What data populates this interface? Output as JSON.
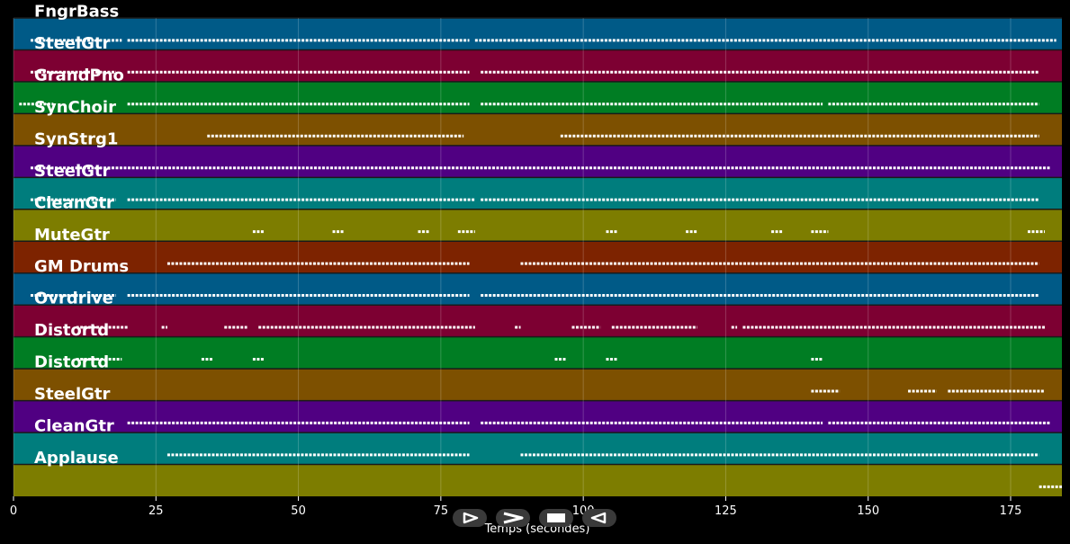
{
  "chart_data": {
    "type": "piano-roll",
    "xlabel": "Temps (secondes)",
    "xlim": [
      0,
      184
    ],
    "xticks": [
      0,
      25,
      50,
      75,
      100,
      125,
      150,
      175
    ],
    "grid": true,
    "tracks": [
      {
        "name": "FngrBass",
        "color": "#005a87",
        "segments": [
          [
            3,
            19
          ],
          [
            20,
            80
          ],
          [
            81,
            183
          ]
        ]
      },
      {
        "name": "SteelGtr",
        "color": "#7d0032",
        "segments": [
          [
            3,
            18
          ],
          [
            20,
            80
          ],
          [
            82,
            180
          ]
        ]
      },
      {
        "name": "GrandPno",
        "color": "#007d23",
        "segments": [
          [
            1,
            7
          ],
          [
            20,
            80
          ],
          [
            82,
            142
          ],
          [
            143,
            180
          ]
        ]
      },
      {
        "name": "SynChoir",
        "color": "#7d5000",
        "segments": [
          [
            34,
            79
          ],
          [
            96,
            180
          ]
        ]
      },
      {
        "name": "SynStrg1",
        "color": "#500082",
        "segments": [
          [
            3,
            182
          ]
        ]
      },
      {
        "name": "SteelGtr",
        "color": "#007d7d",
        "segments": [
          [
            3,
            18
          ],
          [
            20,
            81
          ],
          [
            82,
            180
          ]
        ]
      },
      {
        "name": "CleanGtr",
        "color": "#7d7d00",
        "segments": [
          [
            42,
            44
          ],
          [
            56,
            58
          ],
          [
            71,
            73
          ],
          [
            78,
            81
          ],
          [
            104,
            106
          ],
          [
            118,
            120
          ],
          [
            133,
            135
          ],
          [
            140,
            143
          ],
          [
            178,
            181
          ]
        ]
      },
      {
        "name": "MuteGtr",
        "color": "#7d2300",
        "segments": [
          [
            27,
            80
          ],
          [
            89,
            180
          ]
        ]
      },
      {
        "name": "GM Drums",
        "color": "#005a87",
        "segments": [
          [
            3,
            18
          ],
          [
            20,
            80
          ],
          [
            82,
            180
          ]
        ]
      },
      {
        "name": "Ovrdrive",
        "color": "#7d0032",
        "segments": [
          [
            11,
            20
          ],
          [
            26,
            27
          ],
          [
            37,
            41
          ],
          [
            43,
            81
          ],
          [
            88,
            89
          ],
          [
            98,
            103
          ],
          [
            105,
            120
          ],
          [
            126,
            127
          ],
          [
            128,
            145
          ],
          [
            145,
            181
          ]
        ]
      },
      {
        "name": "Distortd",
        "color": "#007d23",
        "segments": [
          [
            11,
            19
          ],
          [
            33,
            35
          ],
          [
            42,
            44
          ],
          [
            95,
            97
          ],
          [
            104,
            106
          ],
          [
            140,
            142
          ]
        ]
      },
      {
        "name": "Distortd",
        "color": "#7d5000",
        "segments": [
          [
            140,
            145
          ],
          [
            157,
            162
          ],
          [
            164,
            181
          ]
        ]
      },
      {
        "name": "SteelGtr",
        "color": "#500082",
        "segments": [
          [
            20,
            80
          ],
          [
            82,
            142
          ],
          [
            143,
            182
          ]
        ]
      },
      {
        "name": "CleanGtr",
        "color": "#007d7d",
        "segments": [
          [
            27,
            80
          ],
          [
            89,
            180
          ]
        ]
      },
      {
        "name": "Applause",
        "color": "#7d7d00",
        "segments": [
          [
            180,
            184
          ]
        ]
      }
    ]
  },
  "controls": [
    {
      "name": "rewind-button",
      "icon": "rewind-icon"
    },
    {
      "name": "play-button",
      "icon": "play-icon"
    },
    {
      "name": "stop-button",
      "icon": "stop-icon"
    },
    {
      "name": "reverse-button",
      "icon": "reverse-icon"
    }
  ]
}
